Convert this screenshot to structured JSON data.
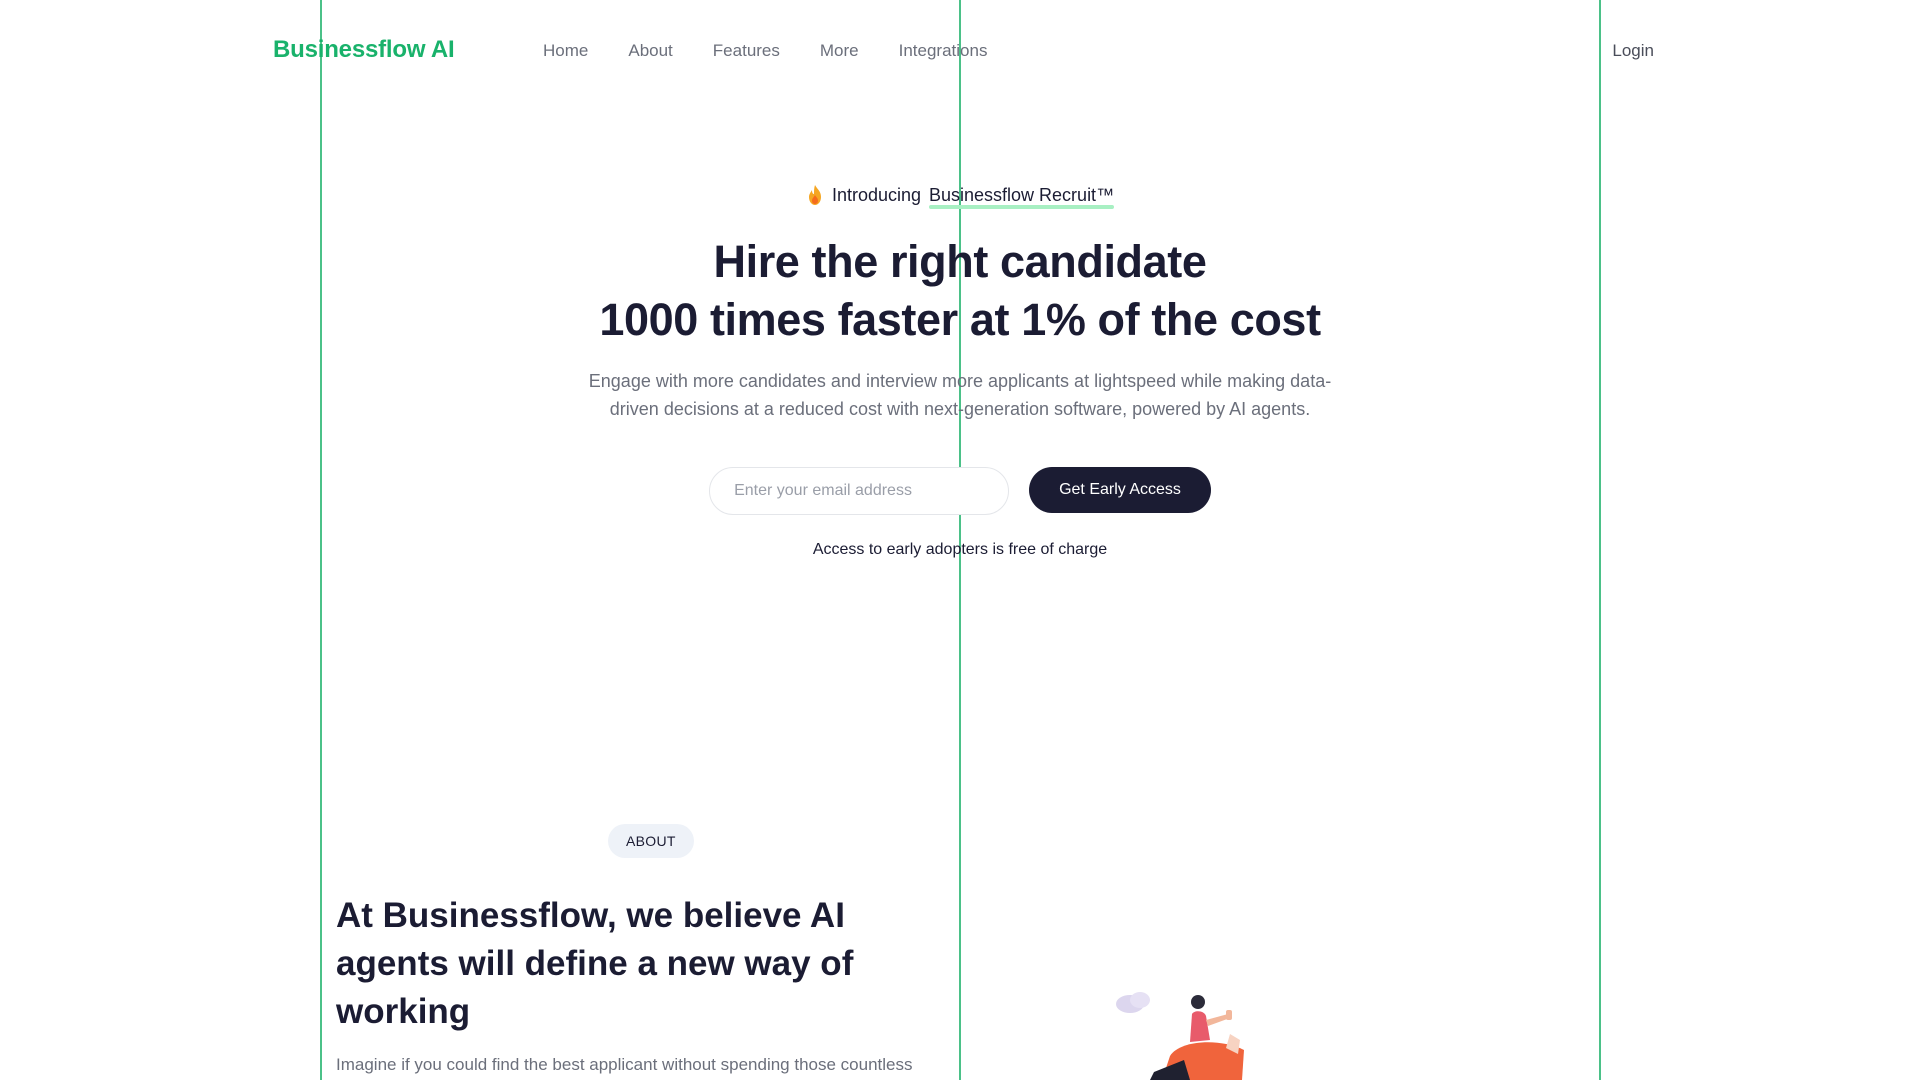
{
  "brand": {
    "logo": "Businessflow AI",
    "accent": "#19b26b"
  },
  "nav": {
    "links": [
      "Home",
      "About",
      "Features",
      "More",
      "Integrations"
    ],
    "login": "Login"
  },
  "hero": {
    "intro_prefix": "Introducing",
    "intro_name": "Businessflow Recruit™",
    "intro_icon": "flame-icon",
    "headline_line1": "Hire the right candidate",
    "headline_hl1": "1000 times faster",
    "headline_mid": "at",
    "headline_hl2": "1% of the cost",
    "subtitle": "Engage with more candidates and interview more applicants at lightspeed while making data-driven decisions at a reduced cost with next-generation software, powered by AI agents.",
    "email_placeholder": "Enter your email address",
    "email_value": "",
    "cta_label": "Get Early Access",
    "note": "Access to early adopters is free of charge"
  },
  "about": {
    "badge": "ABOUT",
    "title": "At Businessflow, we believe AI agents will define a new way of working",
    "text": "Imagine if you could find the best applicant without spending those countless"
  },
  "colors": {
    "dark": "#1b1c33",
    "muted": "#6b6f7b",
    "highlight": "#7de8a6",
    "guide": "#2bb673"
  }
}
